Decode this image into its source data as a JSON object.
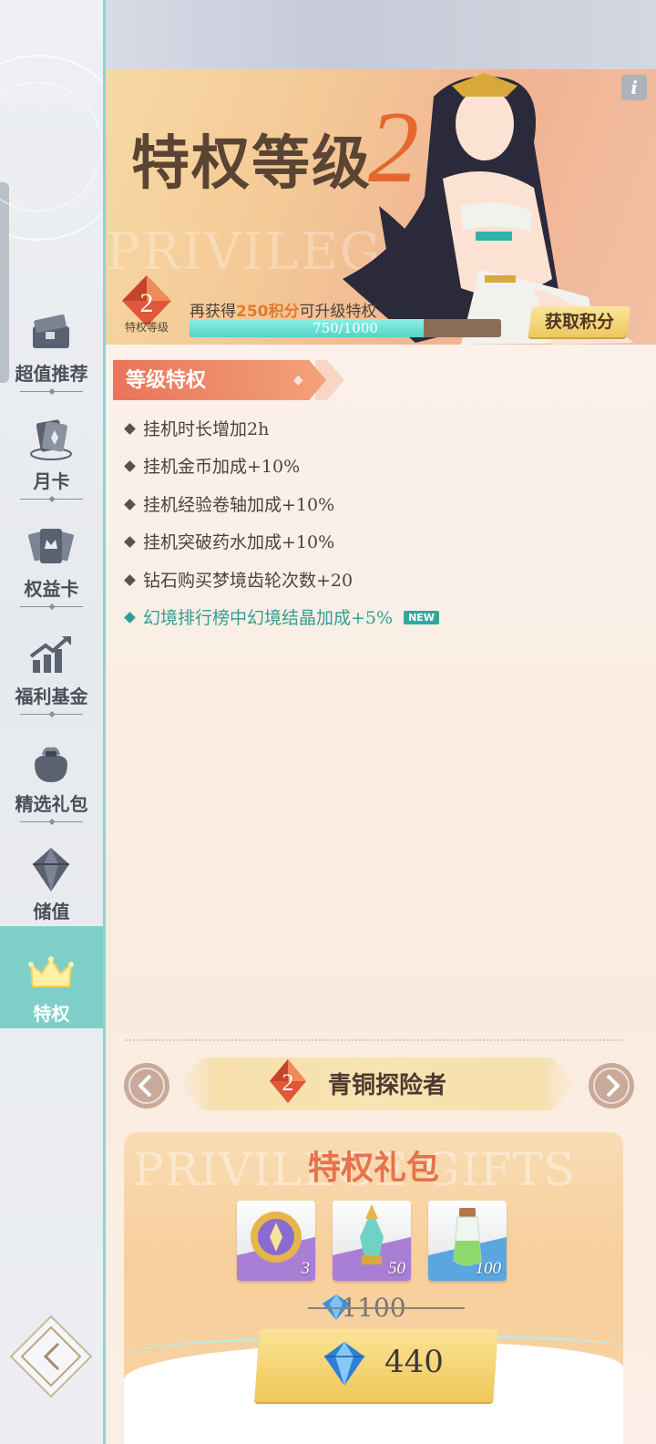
{
  "sidebar": {
    "items": [
      {
        "label": "超值推荐",
        "icon": "treasure-chest-icon"
      },
      {
        "label": "月卡",
        "icon": "month-card-icon"
      },
      {
        "label": "权益卡",
        "icon": "benefit-card-icon"
      },
      {
        "label": "福利基金",
        "icon": "growth-chart-icon"
      },
      {
        "label": "精选礼包",
        "icon": "gift-bag-icon"
      },
      {
        "label": "储值",
        "icon": "diamond-icon"
      },
      {
        "label": "特权",
        "icon": "crown-icon",
        "active": true
      }
    ]
  },
  "banner": {
    "title": "特权等级",
    "level": "2",
    "watermark": "PRIVILEGE",
    "info_label": "i",
    "badge_level": "2",
    "badge_label": "特权等级",
    "upgrade_prefix": "再获得",
    "upgrade_points": "250积分",
    "upgrade_suffix": "可升级特权",
    "progress_text": "750/1000",
    "progress_ratio": 0.75,
    "earn_button": "获取积分"
  },
  "perks": {
    "section_title": "等级特权",
    "items": [
      {
        "text": "挂机时长增加2h"
      },
      {
        "text": "挂机金币加成+10%"
      },
      {
        "text": "挂机经验卷轴加成+10%"
      },
      {
        "text": "挂机突破药水加成+10%"
      },
      {
        "text": "钻石购买梦境齿轮次数+20"
      },
      {
        "text": "幻境排行榜中幻境结晶加成+5%",
        "new": true
      }
    ],
    "new_tag": "NEW"
  },
  "level_selector": {
    "level": "2",
    "name": "青铜探险者"
  },
  "gift": {
    "watermark": "PRIVILEGE GIFTS",
    "title": "特权礼包",
    "items": [
      {
        "icon": "gold-medal-icon",
        "qty": "3"
      },
      {
        "icon": "crystal-potion-icon",
        "qty": "50"
      },
      {
        "icon": "green-potion-icon",
        "qty": "100"
      }
    ],
    "original_price": "1100",
    "price": "440"
  },
  "colors": {
    "accent_teal": "#7ecfc8",
    "accent_orange": "#e4672e",
    "new_green": "#2e9e95"
  }
}
